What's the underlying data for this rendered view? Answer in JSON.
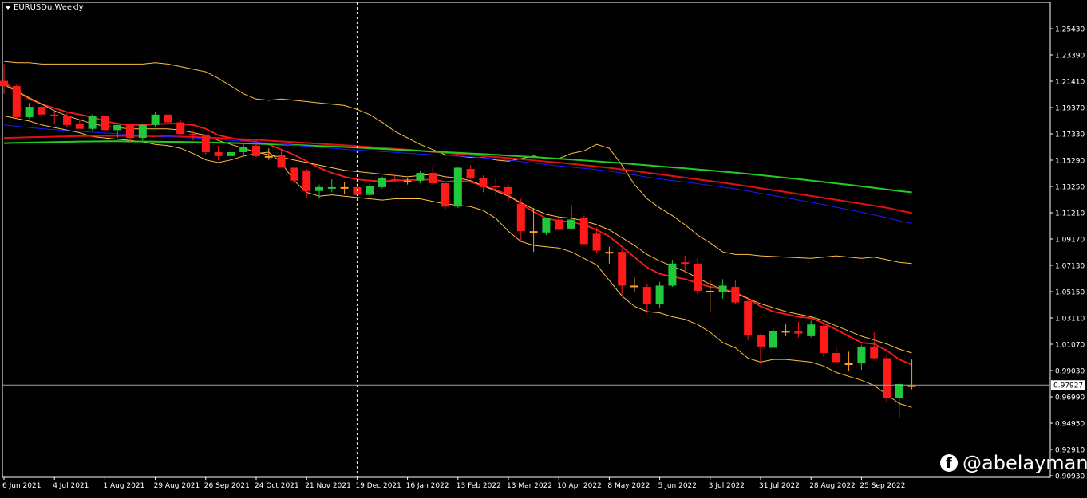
{
  "header": {
    "symbol": "EURUSDu,Weekly"
  },
  "watermark": {
    "handle": "@abelayman"
  },
  "price_axis": {
    "ticks": [
      "1.25430",
      "1.23390",
      "1.21410",
      "1.19370",
      "1.17330",
      "1.15290",
      "1.13250",
      "1.11210",
      "1.09170",
      "1.07130",
      "1.05150",
      "1.03110",
      "1.01070",
      "0.99030",
      "0.96990",
      "0.94950",
      "0.92910",
      "0.90930"
    ],
    "current_price_label": "0.97927"
  },
  "time_axis": {
    "ticks": [
      "6 Jun 2021",
      "4 Jul 2021",
      "1 Aug 2021",
      "29 Aug 2021",
      "26 Sep 2021",
      "24 Oct 2021",
      "21 Nov 2021",
      "19 Dec 2021",
      "16 Jan 2022",
      "13 Feb 2022",
      "13 Mar 2022",
      "10 Apr 2022",
      "8 May 2022",
      "5 Jun 2022",
      "3 Jul 2022",
      "31 Jul 2022",
      "28 Aug 2022",
      "25 Sep 2022"
    ]
  },
  "colors": {
    "background": "#000000",
    "bull": "#22c83c",
    "bear": "#ff1a1a",
    "doji": "#ffa020",
    "grid_text": "#ffffff",
    "ma_fast": "#ff1a1a",
    "ma_long_red": "#e01010",
    "ma_long_green": "#22cc22",
    "ma_blue": "#1a1aff",
    "bands": "#ffc040"
  },
  "chart_data": {
    "type": "candlestick",
    "title": "EURUSDu,Weekly",
    "ylim": [
      0.9093,
      1.2543
    ],
    "grid": false,
    "crosshair": {
      "x": "19 Dec 2021",
      "y": 0.97927
    },
    "candles": [
      {
        "o": 1.214,
        "h": 1.227,
        "l": 1.204,
        "c": 1.21
      },
      {
        "o": 1.21,
        "h": 1.211,
        "l": 1.185,
        "c": 1.186
      },
      {
        "o": 1.186,
        "h": 1.197,
        "l": 1.185,
        "c": 1.194
      },
      {
        "o": 1.194,
        "h": 1.197,
        "l": 1.179,
        "c": 1.188
      },
      {
        "o": 1.188,
        "h": 1.19,
        "l": 1.181,
        "c": 1.187
      },
      {
        "o": 1.187,
        "h": 1.189,
        "l": 1.178,
        "c": 1.18
      },
      {
        "o": 1.181,
        "h": 1.184,
        "l": 1.177,
        "c": 1.177
      },
      {
        "o": 1.177,
        "h": 1.188,
        "l": 1.176,
        "c": 1.187
      },
      {
        "o": 1.187,
        "h": 1.189,
        "l": 1.175,
        "c": 1.176
      },
      {
        "o": 1.176,
        "h": 1.18,
        "l": 1.17,
        "c": 1.18
      },
      {
        "o": 1.18,
        "h": 1.181,
        "l": 1.166,
        "c": 1.17
      },
      {
        "o": 1.17,
        "h": 1.181,
        "l": 1.168,
        "c": 1.18
      },
      {
        "o": 1.18,
        "h": 1.19,
        "l": 1.178,
        "c": 1.188
      },
      {
        "o": 1.188,
        "h": 1.19,
        "l": 1.18,
        "c": 1.182
      },
      {
        "o": 1.182,
        "h": 1.184,
        "l": 1.172,
        "c": 1.173
      },
      {
        "o": 1.173,
        "h": 1.176,
        "l": 1.168,
        "c": 1.172
      },
      {
        "o": 1.172,
        "h": 1.173,
        "l": 1.157,
        "c": 1.159
      },
      {
        "o": 1.159,
        "h": 1.164,
        "l": 1.153,
        "c": 1.156
      },
      {
        "o": 1.156,
        "h": 1.162,
        "l": 1.154,
        "c": 1.159
      },
      {
        "o": 1.159,
        "h": 1.165,
        "l": 1.156,
        "c": 1.163
      },
      {
        "o": 1.164,
        "h": 1.169,
        "l": 1.155,
        "c": 1.156
      },
      {
        "o": 1.156,
        "h": 1.162,
        "l": 1.153,
        "c": 1.156
      },
      {
        "o": 1.157,
        "h": 1.161,
        "l": 1.15,
        "c": 1.147
      },
      {
        "o": 1.147,
        "h": 1.148,
        "l": 1.136,
        "c": 1.137
      },
      {
        "o": 1.145,
        "h": 1.146,
        "l": 1.124,
        "c": 1.129
      },
      {
        "o": 1.129,
        "h": 1.134,
        "l": 1.123,
        "c": 1.132
      },
      {
        "o": 1.131,
        "h": 1.138,
        "l": 1.128,
        "c": 1.132
      },
      {
        "o": 1.132,
        "h": 1.136,
        "l": 1.127,
        "c": 1.132
      },
      {
        "o": 1.132,
        "h": 1.135,
        "l": 1.126,
        "c": 1.126
      },
      {
        "o": 1.126,
        "h": 1.136,
        "l": 1.125,
        "c": 1.133
      },
      {
        "o": 1.132,
        "h": 1.14,
        "l": 1.131,
        "c": 1.139
      },
      {
        "o": 1.138,
        "h": 1.142,
        "l": 1.136,
        "c": 1.137
      },
      {
        "o": 1.137,
        "h": 1.139,
        "l": 1.134,
        "c": 1.137
      },
      {
        "o": 1.137,
        "h": 1.145,
        "l": 1.135,
        "c": 1.143
      },
      {
        "o": 1.143,
        "h": 1.148,
        "l": 1.134,
        "c": 1.135
      },
      {
        "o": 1.135,
        "h": 1.136,
        "l": 1.115,
        "c": 1.117
      },
      {
        "o": 1.117,
        "h": 1.148,
        "l": 1.116,
        "c": 1.147
      },
      {
        "o": 1.146,
        "h": 1.149,
        "l": 1.138,
        "c": 1.139
      },
      {
        "o": 1.139,
        "h": 1.141,
        "l": 1.128,
        "c": 1.132
      },
      {
        "o": 1.133,
        "h": 1.139,
        "l": 1.125,
        "c": 1.132
      },
      {
        "o": 1.132,
        "h": 1.134,
        "l": 1.121,
        "c": 1.127
      },
      {
        "o": 1.119,
        "h": 1.123,
        "l": 1.09,
        "c": 1.098
      },
      {
        "o": 1.098,
        "h": 1.116,
        "l": 1.082,
        "c": 1.098
      },
      {
        "o": 1.097,
        "h": 1.108,
        "l": 1.095,
        "c": 1.108
      },
      {
        "o": 1.107,
        "h": 1.108,
        "l": 1.099,
        "c": 1.099
      },
      {
        "o": 1.1,
        "h": 1.118,
        "l": 1.099,
        "c": 1.107
      },
      {
        "o": 1.108,
        "h": 1.11,
        "l": 1.088,
        "c": 1.088
      },
      {
        "o": 1.096,
        "h": 1.101,
        "l": 1.081,
        "c": 1.083
      },
      {
        "o": 1.082,
        "h": 1.086,
        "l": 1.073,
        "c": 1.082
      },
      {
        "o": 1.082,
        "h": 1.084,
        "l": 1.048,
        "c": 1.056
      },
      {
        "o": 1.056,
        "h": 1.062,
        "l": 1.051,
        "c": 1.056
      },
      {
        "o": 1.055,
        "h": 1.057,
        "l": 1.035,
        "c": 1.042
      },
      {
        "o": 1.042,
        "h": 1.059,
        "l": 1.039,
        "c": 1.056
      },
      {
        "o": 1.056,
        "h": 1.076,
        "l": 1.055,
        "c": 1.073
      },
      {
        "o": 1.074,
        "h": 1.079,
        "l": 1.066,
        "c": 1.073
      },
      {
        "o": 1.073,
        "h": 1.077,
        "l": 1.05,
        "c": 1.052
      },
      {
        "o": 1.052,
        "h": 1.06,
        "l": 1.036,
        "c": 1.052
      },
      {
        "o": 1.051,
        "h": 1.061,
        "l": 1.046,
        "c": 1.056
      },
      {
        "o": 1.055,
        "h": 1.06,
        "l": 1.042,
        "c": 1.043
      },
      {
        "o": 1.044,
        "h": 1.047,
        "l": 1.014,
        "c": 1.018
      },
      {
        "o": 1.018,
        "h": 1.019,
        "l": 0.995,
        "c": 1.009
      },
      {
        "o": 1.008,
        "h": 1.023,
        "l": 1.008,
        "c": 1.021
      },
      {
        "o": 1.021,
        "h": 1.026,
        "l": 1.017,
        "c": 1.021
      },
      {
        "o": 1.021,
        "h": 1.028,
        "l": 1.016,
        "c": 1.019
      },
      {
        "o": 1.017,
        "h": 1.029,
        "l": 1.016,
        "c": 1.026
      },
      {
        "o": 1.025,
        "h": 1.027,
        "l": 1.001,
        "c": 1.004
      },
      {
        "o": 1.004,
        "h": 1.009,
        "l": 0.995,
        "c": 0.997
      },
      {
        "o": 0.996,
        "h": 1.005,
        "l": 0.99,
        "c": 0.996
      },
      {
        "o": 0.996,
        "h": 1.01,
        "l": 0.991,
        "c": 1.009
      },
      {
        "o": 1.009,
        "h": 1.02,
        "l": 0.999,
        "c": 1.0
      },
      {
        "o": 1.0,
        "h": 1.002,
        "l": 0.966,
        "c": 0.969
      },
      {
        "o": 0.969,
        "h": 0.981,
        "l": 0.954,
        "c": 0.98
      },
      {
        "o": 0.979,
        "h": 0.999,
        "l": 0.976,
        "c": 0.979
      }
    ],
    "indicators": [
      {
        "name": "ma_fast",
        "values": [
          1.213,
          1.206,
          1.2,
          1.196,
          1.193,
          1.19,
          1.188,
          1.186,
          1.183,
          1.181,
          1.18,
          1.18,
          1.1805,
          1.181,
          1.181,
          1.18,
          1.177,
          1.172,
          1.17,
          1.168,
          1.167,
          1.165,
          1.161,
          1.157,
          1.152,
          1.147,
          1.143,
          1.14,
          1.138,
          1.137,
          1.1365,
          1.137,
          1.1375,
          1.1375,
          1.138,
          1.136,
          1.137,
          1.136,
          1.133,
          1.13,
          1.126,
          1.119,
          1.113,
          1.108,
          1.106,
          1.105,
          1.103,
          1.099,
          1.094,
          1.086,
          1.078,
          1.07,
          1.065,
          1.063,
          1.061,
          1.058,
          1.055,
          1.053,
          1.051,
          1.046,
          1.04,
          1.036,
          1.034,
          1.032,
          1.031,
          1.027,
          1.022,
          1.017,
          1.012,
          1.011,
          1.006,
          0.999,
          0.995
        ]
      },
      {
        "name": "band_upper",
        "values": [
          1.229,
          1.228,
          1.228,
          1.227,
          1.227,
          1.227,
          1.227,
          1.227,
          1.227,
          1.227,
          1.227,
          1.227,
          1.228,
          1.227,
          1.225,
          1.223,
          1.221,
          1.216,
          1.21,
          1.204,
          1.2,
          1.199,
          1.2,
          1.199,
          1.198,
          1.197,
          1.196,
          1.195,
          1.192,
          1.188,
          1.182,
          1.175,
          1.17,
          1.165,
          1.161,
          1.157,
          1.156,
          1.155,
          1.155,
          1.153,
          1.152,
          1.154,
          1.156,
          1.154,
          1.154,
          1.158,
          1.16,
          1.165,
          1.162,
          1.149,
          1.134,
          1.123,
          1.116,
          1.11,
          1.103,
          1.095,
          1.089,
          1.082,
          1.08,
          1.08,
          1.079,
          1.0785,
          1.078,
          1.0775,
          1.077,
          1.078,
          1.079,
          1.078,
          1.077,
          1.078,
          1.076,
          1.074,
          1.073
        ]
      },
      {
        "name": "band_middle",
        "values": [
          1.211,
          1.206,
          1.201,
          1.196,
          1.191,
          1.187,
          1.184,
          1.181,
          1.179,
          1.178,
          1.177,
          1.177,
          1.177,
          1.177,
          1.176,
          1.174,
          1.172,
          1.168,
          1.165,
          1.162,
          1.159,
          1.157,
          1.155,
          1.153,
          1.151,
          1.149,
          1.147,
          1.145,
          1.144,
          1.143,
          1.142,
          1.141,
          1.14,
          1.141,
          1.142,
          1.14,
          1.139,
          1.137,
          1.133,
          1.129,
          1.125,
          1.12,
          1.115,
          1.111,
          1.109,
          1.108,
          1.106,
          1.103,
          1.099,
          1.093,
          1.087,
          1.08,
          1.075,
          1.071,
          1.067,
          1.062,
          1.057,
          1.053,
          1.05,
          1.046,
          1.042,
          1.039,
          1.036,
          1.034,
          1.032,
          1.029,
          1.025,
          1.021,
          1.017,
          1.014,
          1.011,
          1.007,
          1.004
        ]
      },
      {
        "name": "band_lower",
        "values": [
          1.187,
          1.185,
          1.183,
          1.18,
          1.178,
          1.176,
          1.174,
          1.171,
          1.17,
          1.169,
          1.168,
          1.167,
          1.165,
          1.164,
          1.162,
          1.158,
          1.153,
          1.151,
          1.153,
          1.156,
          1.158,
          1.159,
          1.151,
          1.137,
          1.128,
          1.125,
          1.126,
          1.125,
          1.124,
          1.123,
          1.122,
          1.123,
          1.123,
          1.123,
          1.121,
          1.119,
          1.118,
          1.117,
          1.114,
          1.108,
          1.098,
          1.09,
          1.087,
          1.086,
          1.085,
          1.082,
          1.077,
          1.072,
          1.06,
          1.048,
          1.04,
          1.036,
          1.035,
          1.032,
          1.03,
          1.026,
          1.02,
          1.012,
          1.008,
          1.0,
          0.997,
          0.999,
          0.999,
          0.998,
          0.997,
          0.994,
          0.989,
          0.986,
          0.983,
          0.979,
          0.972,
          0.965,
          0.962
        ]
      },
      {
        "name": "ma_long_red",
        "values": [
          1.17,
          1.1702,
          1.1705,
          1.1707,
          1.171,
          1.1712,
          1.1714,
          1.1715,
          1.1716,
          1.1716,
          1.1715,
          1.1714,
          1.1713,
          1.1712,
          1.171,
          1.1707,
          1.1703,
          1.1699,
          1.1695,
          1.169,
          1.1685,
          1.1679,
          1.1673,
          1.1667,
          1.1661,
          1.1655,
          1.1649,
          1.1643,
          1.1637,
          1.163,
          1.1623,
          1.1616,
          1.1609,
          1.1601,
          1.1593,
          1.1585,
          1.1577,
          1.1569,
          1.1561,
          1.1553,
          1.1545,
          1.1536,
          1.1527,
          1.1518,
          1.1509,
          1.15,
          1.149,
          1.148,
          1.1469,
          1.1457,
          1.1445,
          1.1432,
          1.1419,
          1.1406,
          1.1393,
          1.138,
          1.1367,
          1.1354,
          1.1341,
          1.1327,
          1.1312,
          1.1297,
          1.1282,
          1.1267,
          1.1252,
          1.1237,
          1.1222,
          1.1207,
          1.1192,
          1.1177,
          1.1162,
          1.114,
          1.112
        ]
      },
      {
        "name": "ma_long_green",
        "values": [
          1.166,
          1.1662,
          1.1664,
          1.1666,
          1.1668,
          1.167,
          1.1672,
          1.1673,
          1.1674,
          1.1674,
          1.1673,
          1.1672,
          1.1671,
          1.167,
          1.1669,
          1.1667,
          1.1665,
          1.1663,
          1.1661,
          1.1658,
          1.1655,
          1.1652,
          1.1649,
          1.1646,
          1.1642,
          1.1638,
          1.1634,
          1.163,
          1.1625,
          1.162,
          1.1615,
          1.161,
          1.1605,
          1.16,
          1.1595,
          1.159,
          1.1585,
          1.158,
          1.1575,
          1.157,
          1.1564,
          1.1558,
          1.1552,
          1.1546,
          1.154,
          1.1533,
          1.1526,
          1.1519,
          1.1512,
          1.1505,
          1.1497,
          1.1489,
          1.1481,
          1.1473,
          1.1465,
          1.1457,
          1.1449,
          1.144,
          1.1431,
          1.1422,
          1.1412,
          1.1402,
          1.1392,
          1.1382,
          1.1371,
          1.136,
          1.1349,
          1.1338,
          1.1326,
          1.1314,
          1.1302,
          1.129,
          1.128
        ]
      },
      {
        "name": "ma_blue",
        "values": [
          1.18,
          1.179,
          1.178,
          1.1771,
          1.1763,
          1.1756,
          1.175,
          1.1744,
          1.1738,
          1.1732,
          1.1726,
          1.172,
          1.1715,
          1.171,
          1.1705,
          1.17,
          1.1695,
          1.1688,
          1.1681,
          1.1674,
          1.1667,
          1.166,
          1.1652,
          1.1644,
          1.1636,
          1.1628,
          1.162,
          1.1613,
          1.1606,
          1.16,
          1.1594,
          1.1588,
          1.1582,
          1.1576,
          1.157,
          1.1565,
          1.156,
          1.1554,
          1.1547,
          1.1538,
          1.1528,
          1.1517,
          1.1505,
          1.1494,
          1.1484,
          1.1475,
          1.1465,
          1.1455,
          1.1443,
          1.1429,
          1.1414,
          1.1398,
          1.1384,
          1.1371,
          1.1359,
          1.1347,
          1.1334,
          1.132,
          1.1306,
          1.129,
          1.1272,
          1.1255,
          1.1238,
          1.122,
          1.1203,
          1.1185,
          1.1165,
          1.1146,
          1.1126,
          1.1105,
          1.1085,
          1.106,
          1.104
        ]
      }
    ]
  }
}
